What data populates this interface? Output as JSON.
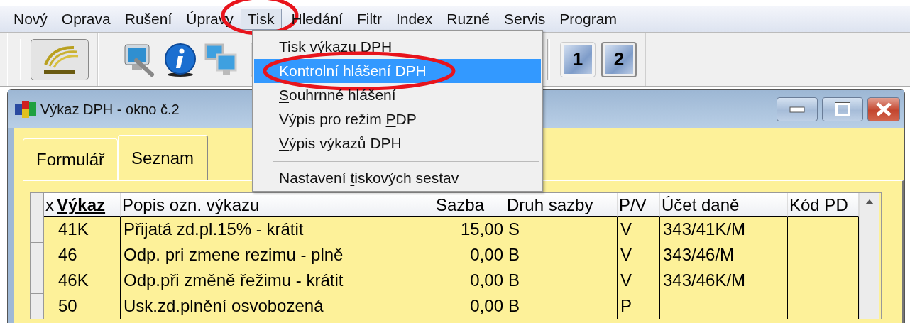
{
  "menu_bar": [
    {
      "label": "Nový",
      "open": false,
      "circled": false
    },
    {
      "label": "Oprava",
      "open": false,
      "circled": false
    },
    {
      "label": "Rušení",
      "open": false,
      "circled": false
    },
    {
      "label": "Úpravy",
      "open": false,
      "circled": false
    },
    {
      "label": "Tisk",
      "open": true,
      "circled": true
    },
    {
      "label": "Hledání",
      "open": false,
      "circled": false
    },
    {
      "label": "Filtr",
      "open": false,
      "circled": false
    },
    {
      "label": "Index",
      "open": false,
      "circled": false
    },
    {
      "label": "Ruzné",
      "open": false,
      "circled": false
    },
    {
      "label": "Servis",
      "open": false,
      "circled": false
    },
    {
      "label": "Program",
      "open": false,
      "circled": false
    }
  ],
  "toolbar": {
    "left_buttons": [
      {
        "kind": "logo"
      },
      {
        "kind": "tools"
      },
      {
        "kind": "info"
      },
      {
        "kind": "network"
      },
      {
        "kind": "edit"
      }
    ],
    "window_buttons": [
      {
        "label": "1",
        "selected": false
      },
      {
        "label": "2",
        "selected": true
      }
    ]
  },
  "dropdown": {
    "items": [
      {
        "kind": "item",
        "before": "Tisk výkazu ",
        "key": "D",
        "after": "PH",
        "selected": false,
        "circled": false
      },
      {
        "kind": "item",
        "before": "Kontrolní hlášení DPH",
        "selected": true,
        "circled": true
      },
      {
        "kind": "item",
        "key": "S",
        "after": "ouhrnné hlášení",
        "selected": false,
        "circled": false
      },
      {
        "kind": "item",
        "before": "Výpis pro režim ",
        "key": "P",
        "after": "DP",
        "selected": false,
        "circled": false
      },
      {
        "kind": "item",
        "key": "V",
        "after": "ýpis výkazů DPH",
        "selected": false,
        "circled": false
      },
      {
        "kind": "separator"
      },
      {
        "kind": "item",
        "before": "Nastavení ",
        "key": "t",
        "after": "iskových sestav",
        "selected": false,
        "circled": false
      }
    ]
  },
  "window": {
    "title": "Výkaz DPH - okno č.2"
  },
  "tabs": [
    {
      "label": "Formulář",
      "selected": false
    },
    {
      "label": "Seznam",
      "selected": true
    }
  ],
  "table": {
    "columns": [
      {
        "label": "x",
        "sorted": false
      },
      {
        "label": "Výkaz",
        "sorted": true
      },
      {
        "label": "Popis ozn. výkazu",
        "sorted": false
      },
      {
        "label": "Sazba",
        "sorted": false
      },
      {
        "label": "Druh sazby",
        "sorted": false
      },
      {
        "label": "P/V",
        "sorted": false
      },
      {
        "label": "Účet daně",
        "sorted": false
      },
      {
        "label": "Kód PD",
        "sorted": false
      }
    ],
    "rows": [
      {
        "vykaz": "41K",
        "popis": "Přijatá zd.pl.15% - krátit",
        "sazba": "15,00",
        "druh": "S",
        "pv": "V",
        "ucet": "343/41K/M"
      },
      {
        "vykaz": "46",
        "popis": "Odp. pri zmene rezimu - plně",
        "sazba": "0,00",
        "druh": "B",
        "pv": "V",
        "ucet": "343/46/M"
      },
      {
        "vykaz": "46K",
        "popis": "Odp.při změně řežimu - krátit",
        "sazba": "0,00",
        "druh": "B",
        "pv": "V",
        "ucet": "343/46K/M"
      },
      {
        "vykaz": "50",
        "popis": "Usk.zd.plnění osvobozená",
        "sazba": "0,00",
        "druh": "B",
        "pv": "P"
      }
    ]
  }
}
